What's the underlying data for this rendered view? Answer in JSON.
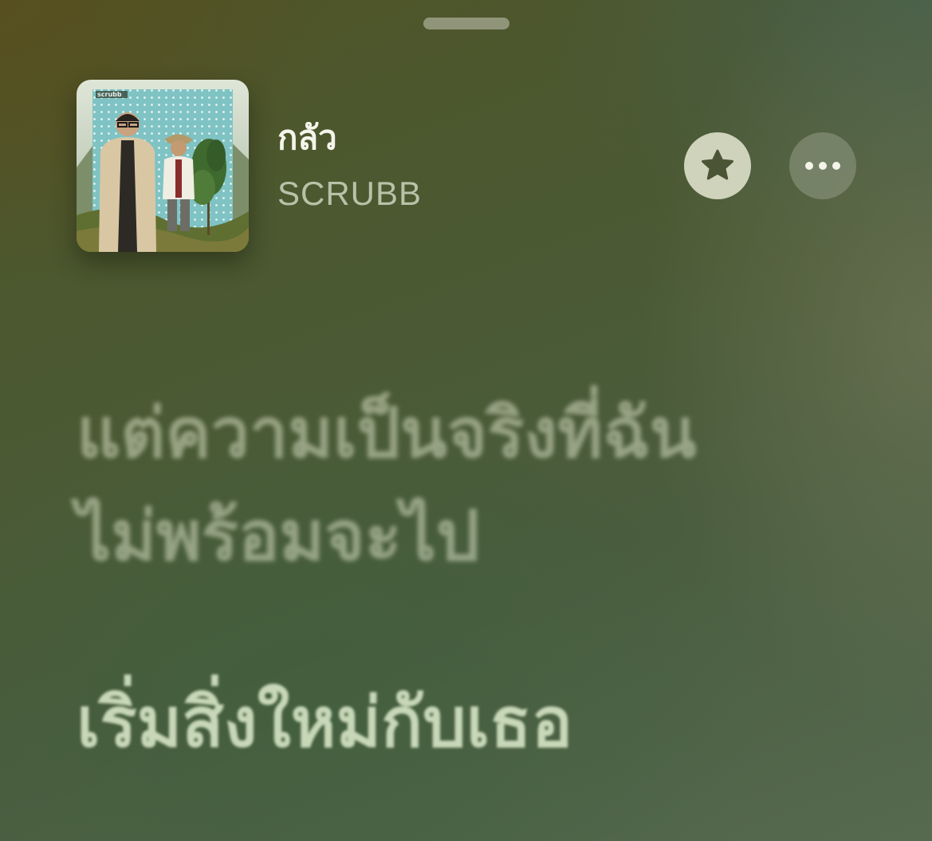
{
  "player": {
    "title": "กลัว",
    "artist": "SCRUBB",
    "artwork_text": "scrubb"
  },
  "controls": {
    "favorite_icon": "star-icon",
    "more_icon": "ellipsis-icon"
  },
  "lyrics": {
    "lines": [
      "แต่ความเป็นจริงที่ฉัน",
      "ไม่พร้อมจะไป",
      "เริ่มสิ่งใหม่กับเธอ"
    ]
  },
  "colors": {
    "favorite_bg": "#cfd3bb",
    "favorite_icon": "#4b5535",
    "lyric_text": "#dae8c8"
  }
}
